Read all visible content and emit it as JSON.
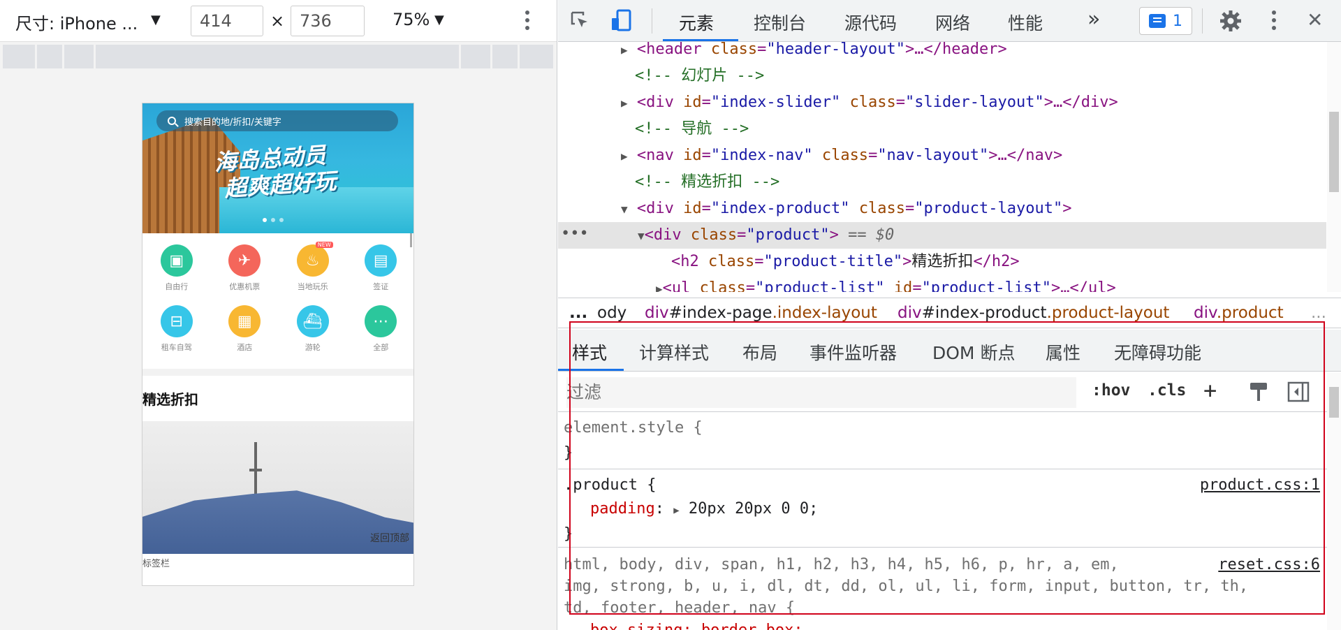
{
  "device_toolbar": {
    "device_label": "尺寸: iPhone ...",
    "width_value": "414",
    "times": "×",
    "height_value": "736",
    "zoom_label": "75%",
    "dropdown_glyph": "▼"
  },
  "device_page": {
    "search_placeholder": "搜索目的地/折扣/关键字",
    "banner_line1": "海岛总动员",
    "banner_line2": "超爽超好玩",
    "nav_items": [
      {
        "label": "自由行",
        "color": "#2bc79c",
        "glyph": "▣"
      },
      {
        "label": "优惠机票",
        "color": "#f4665b",
        "glyph": "✈"
      },
      {
        "label": "当地玩乐",
        "color": "#f8b732",
        "glyph": "♨",
        "badge": "NEW"
      },
      {
        "label": "签证",
        "color": "#36c6e8",
        "glyph": "▤"
      },
      {
        "label": "租车自驾",
        "color": "#36c6e8",
        "glyph": "⊟"
      },
      {
        "label": "酒店",
        "color": "#f8b732",
        "glyph": "▦"
      },
      {
        "label": "游轮",
        "color": "#36c6e8",
        "glyph": "⛴"
      },
      {
        "label": "全部",
        "color": "#2bc79c",
        "glyph": "⋯"
      }
    ],
    "product_title": "精选折扣",
    "back_to_top": "返回顶部",
    "tab_bar_label": "标签栏"
  },
  "devtools": {
    "tabs": [
      "元素",
      "控制台",
      "源代码",
      "网络",
      "性能"
    ],
    "more_tabs": "»",
    "issues_count": "1",
    "close_glyph": "✕",
    "dom": {
      "l1": {
        "tag_open": "<header",
        "attr1": "class",
        "val1": "\"header-layout\"",
        "rest": ">…</header>"
      },
      "c1": "<!-- 幻灯片 -->",
      "l2": {
        "tag_open": "<div",
        "attr1": "id",
        "val1": "\"index-slider\"",
        "attr2": "class",
        "val2": "\"slider-layout\"",
        "rest": ">…</div>"
      },
      "c2": "<!-- 导航 -->",
      "l3": {
        "tag_open": "<nav",
        "attr1": "id",
        "val1": "\"index-nav\"",
        "attr2": "class",
        "val2": "\"nav-layout\"",
        "rest": ">…</nav>"
      },
      "c3": "<!-- 精选折扣 -->",
      "l4": {
        "tag_open": "<div",
        "attr1": "id",
        "val1": "\"index-product\"",
        "attr2": "class",
        "val2": "\"product-layout\"",
        "rest": ">"
      },
      "l5": {
        "tag_open": "<div",
        "attr1": "class",
        "val1": "\"product\"",
        "rest": ">",
        "marker": "== $0"
      },
      "l6": {
        "tag_open": "<h2",
        "attr1": "class",
        "val1": "\"product-title\"",
        "text": "精选折扣",
        "rest": "</h2>"
      },
      "l7": {
        "tag_open": "<ul",
        "attr1": "class",
        "val1": "\"product-list\"",
        "attr2": "id",
        "val2": "\"product-list\"",
        "rest": ">…</ul>"
      },
      "ellipsis": "•••"
    },
    "breadcrumbs": {
      "dots": "...",
      "b0": "ody",
      "b1_tag": "div",
      "b1_id": "#index-page",
      "b1_cls": ".index-layout",
      "b2_tag": "div",
      "b2_id": "#index-product",
      "b2_cls": ".product-layout",
      "b3_tag": "div",
      "b3_cls": ".product",
      "more": "..."
    },
    "sub_tabs": [
      "样式",
      "计算样式",
      "布局",
      "事件监听器",
      "DOM 断点",
      "属性",
      "无障碍功能"
    ],
    "filter_placeholder": "过滤",
    "hov": ":hov",
    "cls": ".cls",
    "plus": "+",
    "styles": {
      "r1_selector": "element.style {",
      "r1_close": "}",
      "r2_selector": ".product {",
      "r2_source": "product.css:1",
      "r2_prop": "padding",
      "r2_value": "20px 20px 0 0;",
      "r2_close": "}",
      "r3_line1": "html, body, div, span, h1, h2, h3, h4, h5, h6, p, hr, a, em,",
      "r3_line2": "img, strong, b, u, i, dl, dt, dd, ol, ul, li, form, input, button, tr, th,",
      "r3_line3": "td, footer, header, nav {",
      "r3_source": "reset.css:6",
      "r3_prop_partial": "box-sizing: border-box;"
    }
  }
}
